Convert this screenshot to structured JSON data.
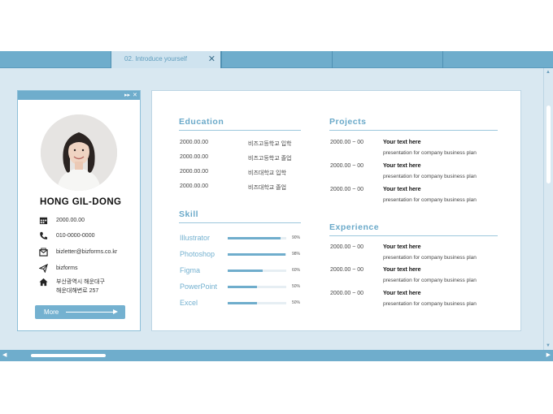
{
  "tabs": [
    {
      "label": "",
      "active": false
    },
    {
      "label": "02. Introduce yourself",
      "active": true,
      "close": "✕"
    },
    {
      "label": "",
      "active": false
    },
    {
      "label": "",
      "active": false
    },
    {
      "label": "",
      "active": false
    }
  ],
  "profile": {
    "header_controls": [
      "▸▸",
      "✕"
    ],
    "name": "HONG GIL-DONG",
    "info": [
      {
        "icon": "calendar-icon",
        "text": "2000.00.00"
      },
      {
        "icon": "phone-icon",
        "text": "010-0000-0000"
      },
      {
        "icon": "mail-icon",
        "text": "bizletter@bizforms.co.kr"
      },
      {
        "icon": "send-icon",
        "text": "bizforms"
      },
      {
        "icon": "home-icon",
        "text": "부산광역시 해운대구\n해운대해변로 257"
      }
    ],
    "more_label": "More"
  },
  "education": {
    "title": "Education",
    "rows": [
      {
        "date": "2000.00.00",
        "desc": "비즈고등학교 입학"
      },
      {
        "date": "2000.00.00",
        "desc": "비즈고등학교 졸업"
      },
      {
        "date": "2000.00.00",
        "desc": "비즈대학교 입학"
      },
      {
        "date": "2000.00.00",
        "desc": "비즈대학교 졸업"
      }
    ]
  },
  "skill": {
    "title": "Skill",
    "rows": [
      {
        "name": "Illustrator",
        "percent": 90,
        "label": "90%"
      },
      {
        "name": "Photoshop",
        "percent": 98,
        "label": "98%"
      },
      {
        "name": "Figma",
        "percent": 60,
        "label": "60%"
      },
      {
        "name": "PowerPoint",
        "percent": 50,
        "label": "50%"
      },
      {
        "name": "Excel",
        "percent": 50,
        "label": "50%"
      }
    ]
  },
  "projects": {
    "title": "Projects",
    "rows": [
      {
        "date": "2000.00 ~ 00",
        "title": "Your text here",
        "desc": "presentation for company business plan"
      },
      {
        "date": "2000.00 ~ 00",
        "title": "Your text here",
        "desc": "presentation for company business plan"
      },
      {
        "date": "2000.00 ~ 00",
        "title": "Your text here",
        "desc": "presentation for company business plan"
      }
    ]
  },
  "experience": {
    "title": "Experience",
    "rows": [
      {
        "date": "2000.00 ~ 00",
        "title": "Your text here",
        "desc": "presentation for company business plan"
      },
      {
        "date": "2000.00 ~ 00",
        "title": "Your text here",
        "desc": "presentation for company business plan"
      },
      {
        "date": "2000.00 ~ 00",
        "title": "Your text here",
        "desc": "presentation for company business plan"
      }
    ]
  },
  "scroll": {
    "up": "▲",
    "down": "▼",
    "left": "◀",
    "right": "▶"
  },
  "colors": {
    "accent": "#6fadcc",
    "background": "#d9e8f1",
    "title": "#6aa9c9"
  }
}
